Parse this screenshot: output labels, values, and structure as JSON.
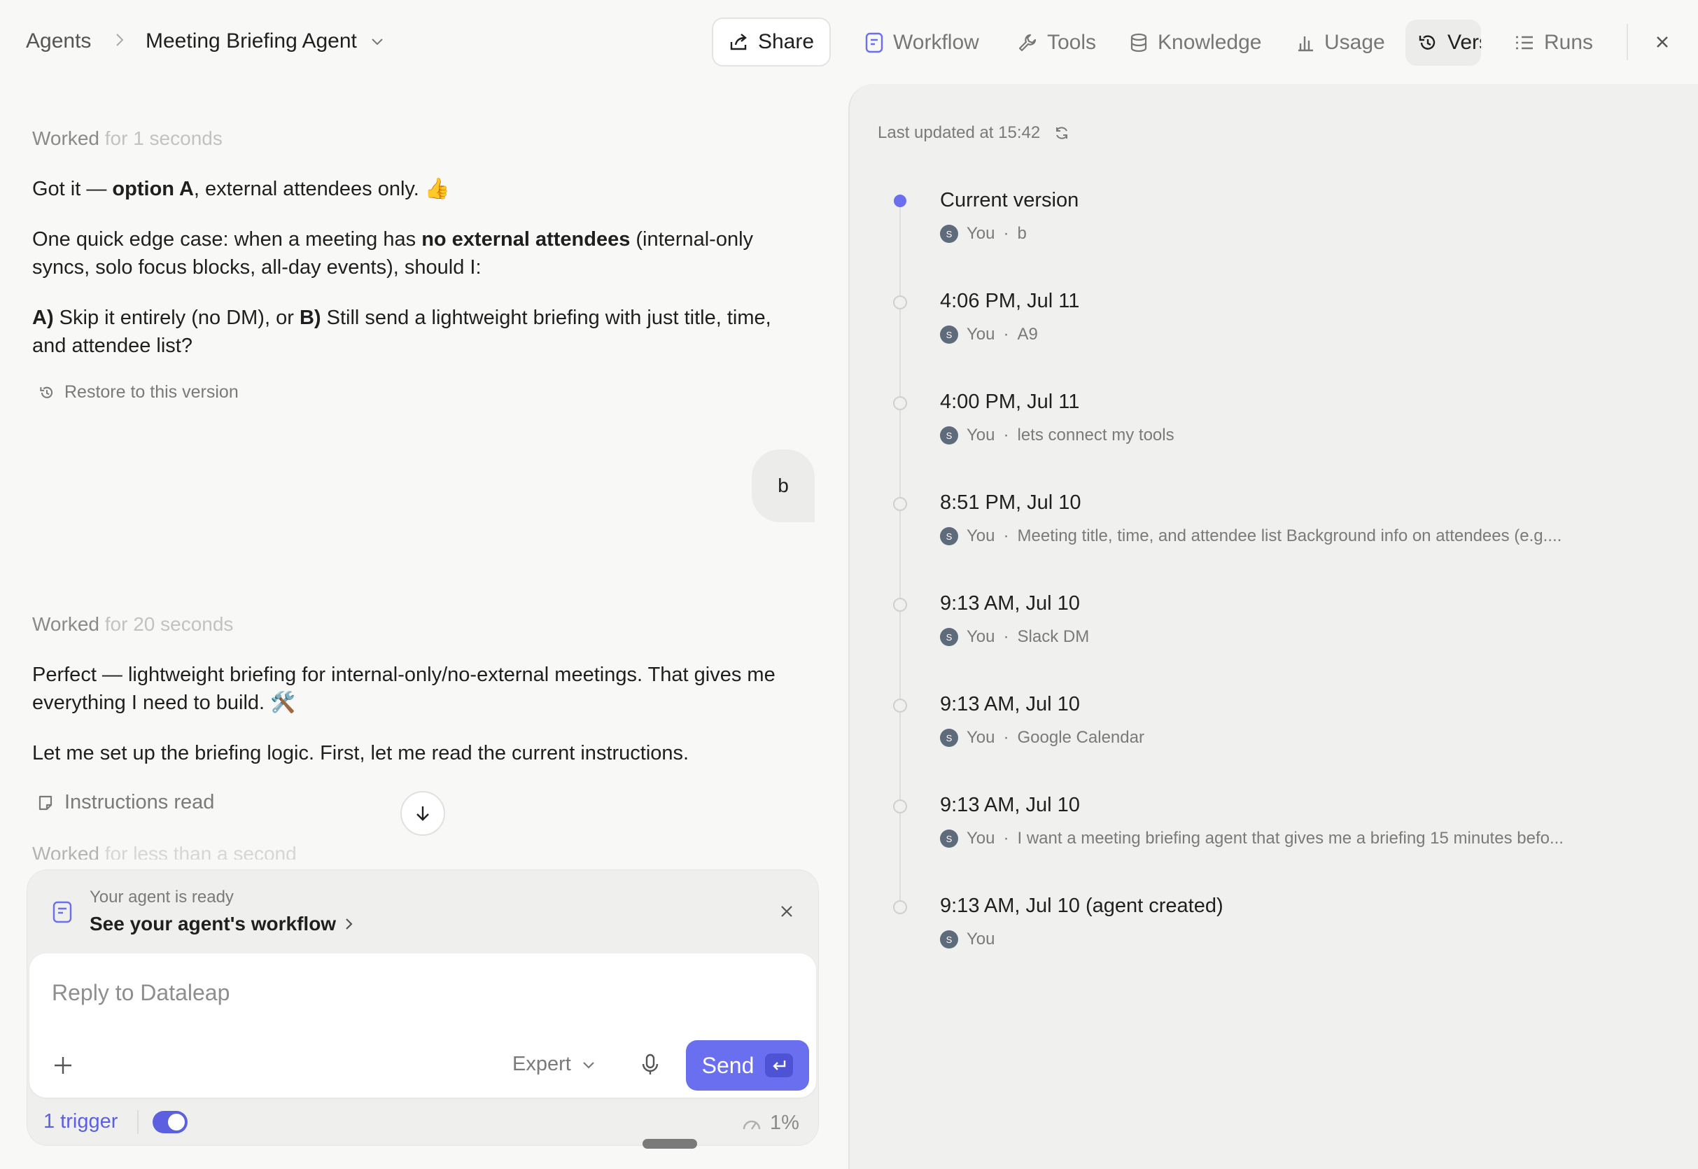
{
  "breadcrumb": {
    "root": "Agents",
    "agent_name": "Meeting Briefing Agent"
  },
  "toolbar": {
    "share_label": "Share",
    "tabs": [
      {
        "label": "Workflow",
        "icon": "document-icon"
      },
      {
        "label": "Tools",
        "icon": "wrench-icon"
      },
      {
        "label": "Knowledge",
        "icon": "database-icon"
      },
      {
        "label": "Usage",
        "icon": "bar-chart-icon"
      },
      {
        "label": "Vers",
        "icon": "history-icon",
        "active": true
      },
      {
        "label": "Runs",
        "icon": "list-icon"
      }
    ]
  },
  "chat": {
    "worked1": {
      "label": "Worked",
      "duration": "for 1 seconds"
    },
    "msg1": {
      "p1_pre": "Got it — ",
      "p1_bold": "option A",
      "p1_post": ", external attendees only. 👍"
    },
    "msg2": {
      "pre": "One quick edge case: when a meeting has ",
      "bold": "no external attendees",
      "post": " (internal-only syncs, solo focus blocks, all-day events), should I:"
    },
    "msg3": {
      "a_label": "A)",
      "a_text": " Skip it entirely (no DM), or ",
      "b_label": "B)",
      "b_text": " Still send a lightweight briefing with just title, time, and attendee list?"
    },
    "restore_label": "Restore to this version",
    "user_reply": "b",
    "worked2": {
      "label": "Worked",
      "duration": "for 20 seconds"
    },
    "msg4": "Perfect — lightweight briefing for internal-only/no-external meetings. That gives me everything I need to build. 🛠️",
    "msg5": "Let me set up the briefing logic. First, let me read the current instructions.",
    "instructions_read": "Instructions read",
    "worked3": {
      "label": "Worked",
      "duration": "for less than a second"
    }
  },
  "composer": {
    "ready_label": "Your agent is ready",
    "workflow_link": "See your agent's workflow",
    "placeholder": "Reply to Dataleap",
    "mode": "Expert",
    "send_label": "Send",
    "trigger_label": "1 trigger",
    "trigger_enabled": true,
    "usage": "1%"
  },
  "versions": {
    "last_updated": "Last updated at 15:42",
    "items": [
      {
        "title": "Current version",
        "author": "You",
        "note": "b",
        "active": true
      },
      {
        "title": "4:06 PM, Jul 11",
        "author": "You",
        "note": "A9"
      },
      {
        "title": "4:00 PM, Jul 11",
        "author": "You",
        "note": "lets connect my tools"
      },
      {
        "title": "8:51 PM, Jul 10",
        "author": "You",
        "note": "Meeting title, time, and attendee list Background info on attendees (e.g...."
      },
      {
        "title": "9:13 AM, Jul 10",
        "author": "You",
        "note": "Slack DM"
      },
      {
        "title": "9:13 AM, Jul 10",
        "author": "You",
        "note": "Google Calendar"
      },
      {
        "title": "9:13 AM, Jul 10",
        "author": "You",
        "note": "I want a meeting briefing agent that gives me a briefing 15 minutes befo..."
      },
      {
        "title": "9:13 AM, Jul 10 (agent created)",
        "author": "You",
        "note": ""
      }
    ],
    "avatar_initial": "S"
  },
  "colors": {
    "accent": "#6a6ff0",
    "link": "#5b5fe0"
  }
}
